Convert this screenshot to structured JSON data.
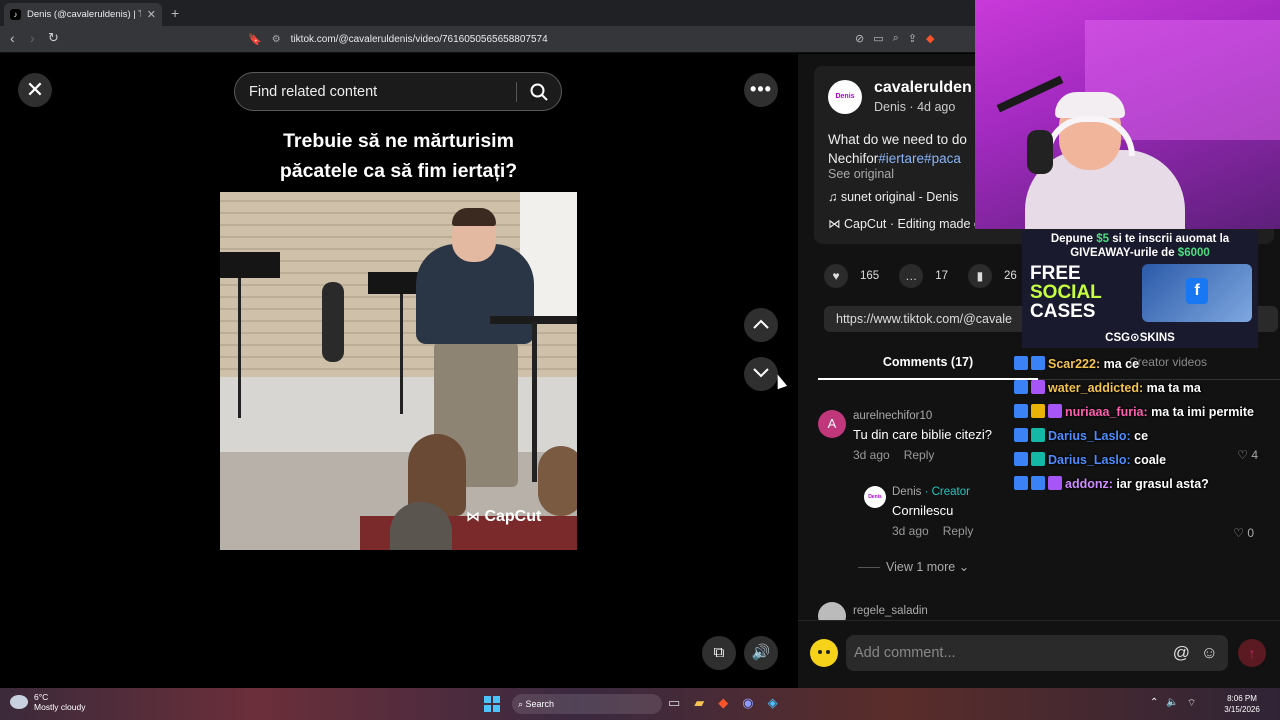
{
  "browser": {
    "tab_title": "Denis (@cavaleruldenis) | TikTok",
    "tab_close": "✕",
    "new_tab": "+",
    "url": "tiktok.com/@cavaleruldenis/video/7616050565658807574"
  },
  "video": {
    "search_placeholder": "Find related content",
    "caption_line1": "Trebuie să ne mărturisim",
    "caption_line2": "păcatele ca să fim iertați?",
    "watermark": "CapCut"
  },
  "post": {
    "avatar_text": "Denis",
    "username": "cavalerulden",
    "subline": "Denis · 4d ago",
    "desc_line1": "What do we need to do",
    "desc_line2_plain": "Nechifor",
    "desc_hashtags": "#iertare#paca",
    "see_original": "See original",
    "music": "♫  sunet original - Denis",
    "capcut": "CapCut · Editing made eas",
    "likes": "165",
    "comments": "17",
    "saves": "26",
    "share_link": "https://www.tiktok.com/@cavale"
  },
  "tabs": {
    "comments": "Comments (17)",
    "creator": "Creator videos"
  },
  "comments": [
    {
      "avatar": "A",
      "user": "aurelnechifor10",
      "text": "Tu din care biblie citezi?",
      "time": "3d ago",
      "reply": "Reply",
      "likes": "4"
    }
  ],
  "reply": {
    "user": "Denis",
    "creator_tag": " · Creator",
    "text": "Cornilescu",
    "time": "3d ago",
    "reply": "Reply",
    "likes": "0"
  },
  "view_more": "View 1 more",
  "comment3_user": "regele_saladin",
  "composer": {
    "placeholder": "Add comment...",
    "at": "@",
    "emoji": "☺",
    "send": "↑"
  },
  "overlay": {
    "ad_line1_pre": "Depune ",
    "ad_line1_amount": "$5",
    "ad_line1_post": " si te inscrii auomat la",
    "ad_line2_pre": "GIVEAWAY-urile de ",
    "ad_line2_amount": "$6000",
    "ad_free": "FREE",
    "ad_social": "SOCIAL",
    "ad_cases": "CASES",
    "ad_brand": "CSG⊙SKINS"
  },
  "chat": [
    {
      "user": "Scar222:",
      "msg": " ma ce",
      "color": "u-yellow"
    },
    {
      "user": "water_addicted:",
      "msg": " ma ta ma",
      "color": "u-yellow"
    },
    {
      "user": "nuriaaa_furia:",
      "msg": " ma ta imi permite",
      "color": "u-pink"
    },
    {
      "user": "Darius_Laslo:",
      "msg": " ce",
      "color": "u-blue"
    },
    {
      "user": "Darius_Laslo:",
      "msg": " coale",
      "color": "u-blue"
    },
    {
      "user": "addonz:",
      "msg": " iar grasul asta?",
      "color": "u-purple"
    }
  ],
  "taskbar": {
    "temp": "6°C",
    "weather": "Mostly cloudy",
    "search": "Search",
    "time": "8:06 PM",
    "date": "3/15/2026"
  }
}
